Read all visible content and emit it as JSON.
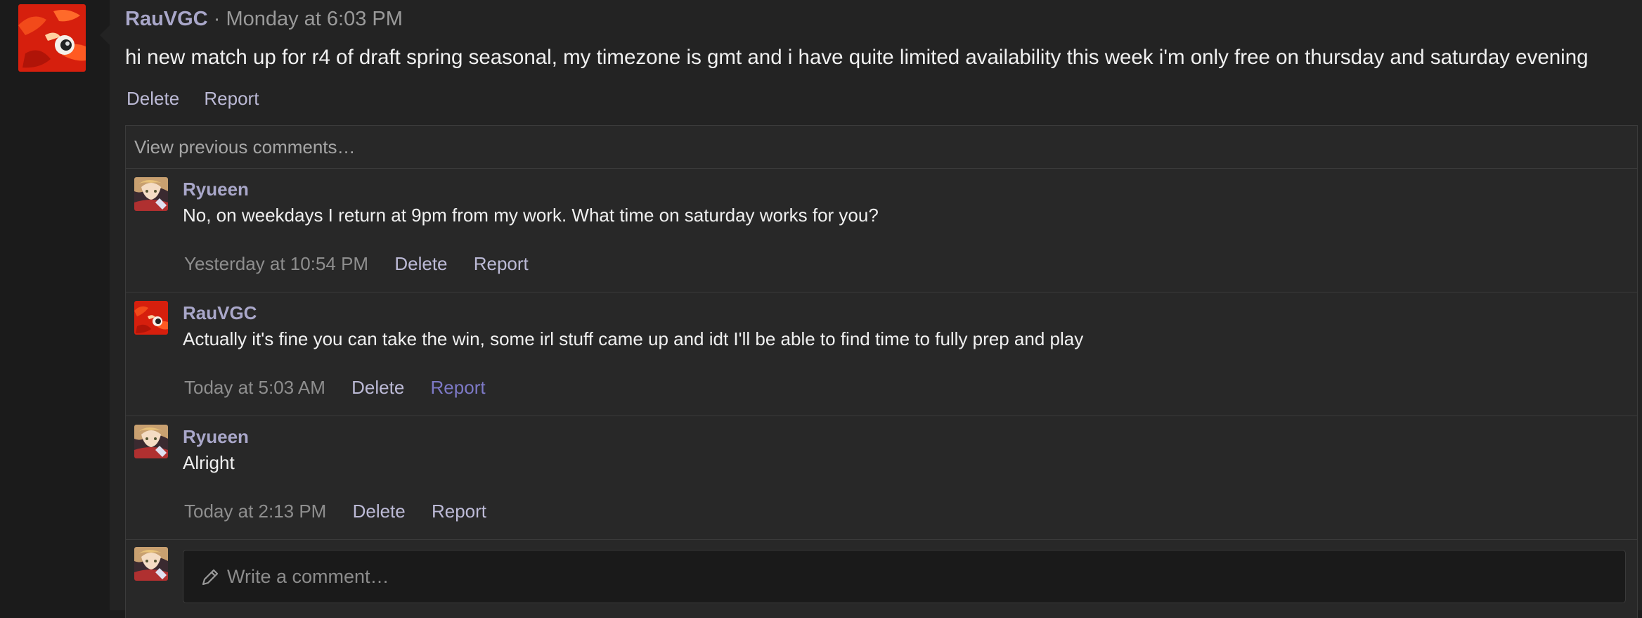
{
  "post": {
    "username": "RauVGC",
    "separator": "·",
    "timestamp": "Monday at 6:03 PM",
    "body": "hi new match up for r4 of draft spring seasonal, my timezone is gmt and i have quite limited availability this week i'm only free on thursday and saturday evening",
    "actions": {
      "delete": "Delete",
      "report": "Report"
    }
  },
  "comments": {
    "view_previous": "View previous comments…",
    "items": [
      {
        "username": "Ryueen",
        "text": "No, on weekdays I return at 9pm from my work. What time on saturday works for you?",
        "time": "Yesterday at 10:54 PM",
        "delete": "Delete",
        "report": "Report"
      },
      {
        "username": "RauVGC",
        "text": "Actually it's fine you can take the win, some irl stuff came up and idt I'll be able to find time to fully prep and play",
        "time": "Today at 5:03 AM",
        "delete": "Delete",
        "report": "Report"
      },
      {
        "username": "Ryueen",
        "text": "Alright",
        "time": "Today at 2:13 PM",
        "delete": "Delete",
        "report": "Report"
      }
    ],
    "compose_placeholder": "Write a comment…"
  },
  "icons": {
    "compose": "pencil-icon"
  },
  "colors": {
    "background": "#1c1c1c",
    "panel": "#232323",
    "username": "#a9a7c9",
    "link": "#bcbad6",
    "link_hover": "#7d79c6",
    "avatar_red": "#d61f0d"
  }
}
